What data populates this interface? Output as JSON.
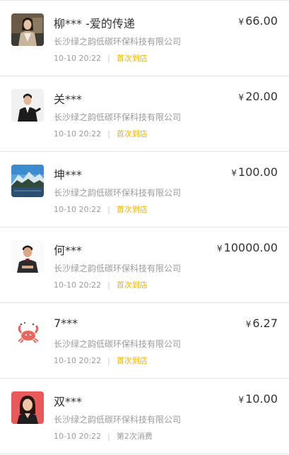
{
  "currency_symbol": "¥",
  "colors": {
    "first_visit_tag": "#f0b400",
    "repeat_tag": "#9b9b9b",
    "separator": "#e5e5e5"
  },
  "records": [
    {
      "name": "柳*** -爱的传递",
      "amount": "66.00",
      "company": "长沙绿之韵低碳环保科技有限公司",
      "time": "10-10 20:22",
      "tag": "首次到店",
      "avatar": "woman-portrait-icon"
    },
    {
      "name": "关***",
      "amount": "20.00",
      "company": "长沙绿之韵低碳环保科技有限公司",
      "time": "10-10 20:22",
      "tag": "首次到店",
      "avatar": "man-suit-portrait-icon"
    },
    {
      "name": "坤***",
      "amount": "100.00",
      "company": "长沙绿之韵低碳环保科技有限公司",
      "time": "10-10 20:22",
      "tag": "首次到店",
      "avatar": "mountain-lake-icon"
    },
    {
      "name": "何***",
      "amount": "10000.00",
      "company": "长沙绿之韵低碳环保科技有限公司",
      "time": "10-10 20:22",
      "tag": "首次到店",
      "avatar": "man-portrait-icon"
    },
    {
      "name": "7***",
      "amount": "6.27",
      "company": "长沙绿之韵低碳环保科技有限公司",
      "time": "10-10 20:22",
      "tag": "首次到店",
      "avatar": "crab-icon"
    },
    {
      "name": "双***",
      "amount": "10.00",
      "company": "长沙绿之韵低碳环保科技有限公司",
      "time": "10-10 20:22",
      "tag": "第2次消费",
      "avatar": "woman-red-background-icon"
    }
  ]
}
